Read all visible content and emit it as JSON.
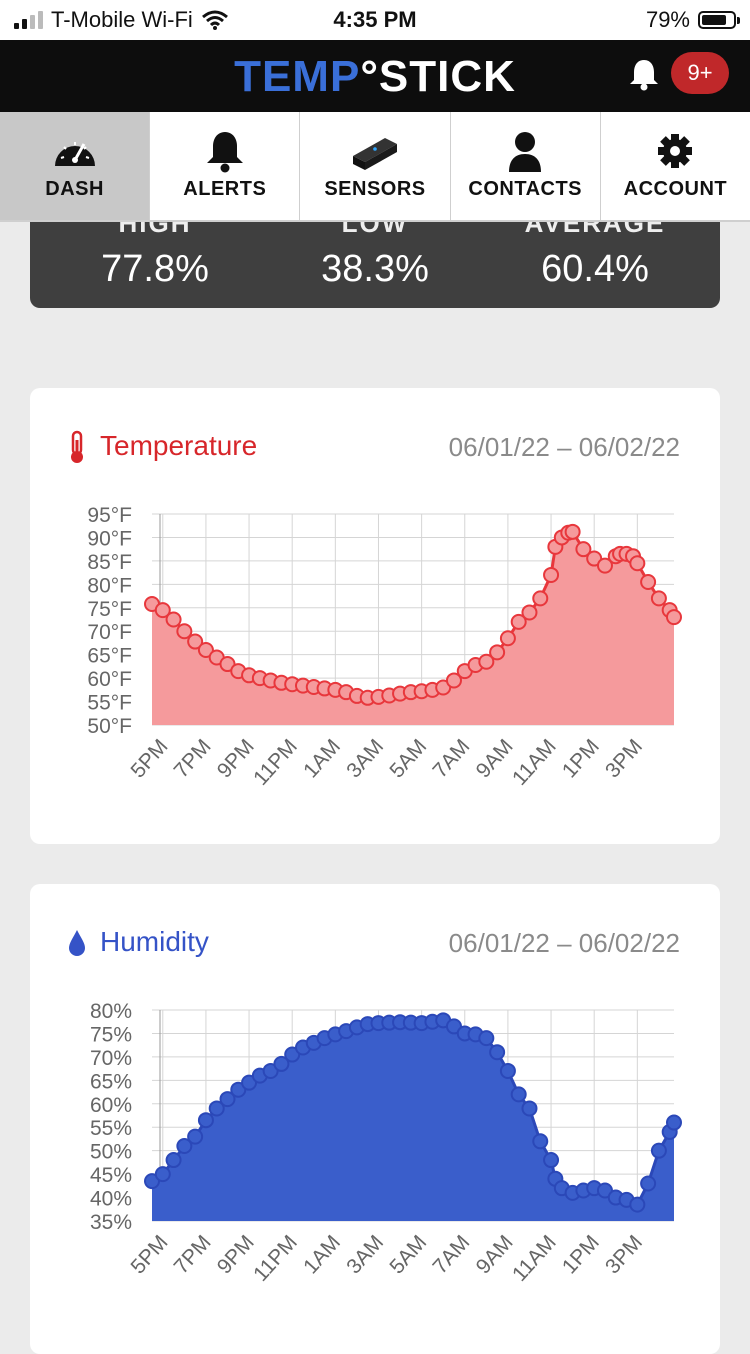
{
  "status_bar": {
    "carrier": "T-Mobile Wi-Fi",
    "time": "4:35 PM",
    "battery": "79%",
    "battery_level": 0.79
  },
  "app": {
    "logo_part1": "TEMP",
    "logo_part2": "STICK",
    "notification_badge": "9+",
    "brand_color": "#3a6fd8"
  },
  "tabs": [
    {
      "label": "DASH",
      "icon": "gauge-icon",
      "active": true
    },
    {
      "label": "ALERTS",
      "icon": "bell-icon",
      "active": false
    },
    {
      "label": "SENSORS",
      "icon": "sensor-icon",
      "active": false
    },
    {
      "label": "CONTACTS",
      "icon": "person-icon",
      "active": false
    },
    {
      "label": "ACCOUNT",
      "icon": "gear-icon",
      "active": false
    }
  ],
  "stats": [
    {
      "label": "HIGH",
      "value": "77.8%"
    },
    {
      "label": "LOW",
      "value": "38.3%"
    },
    {
      "label": "AVERAGE",
      "value": "60.4%"
    }
  ],
  "temperature_card": {
    "title": "Temperature",
    "date_range": "06/01/22 – 06/02/22",
    "color": "#d7262a"
  },
  "humidity_card": {
    "title": "Humidity",
    "date_range": "06/01/22 – 06/02/22",
    "color": "#3553c7"
  },
  "chart_data": [
    {
      "type": "area",
      "x_ticks": [
        "5PM",
        "7PM",
        "9PM",
        "11PM",
        "1AM",
        "3AM",
        "5AM",
        "7AM",
        "9AM",
        "11AM",
        "1PM",
        "3PM"
      ],
      "y_ticks": [
        "95°F",
        "90°F",
        "85°F",
        "80°F",
        "75°F",
        "70°F",
        "65°F",
        "60°F",
        "55°F",
        "50°F"
      ],
      "ylim": [
        50,
        95
      ],
      "xlim": [
        -0.25,
        11.85
      ],
      "grid": true,
      "fill": "#f59a9c",
      "line": "#e8373c",
      "series": [
        {
          "x": [
            -0.25,
            0.0,
            0.25,
            0.5,
            0.75,
            1.0,
            1.25,
            1.5,
            1.75,
            2.0,
            2.25,
            2.5,
            2.75,
            3.0,
            3.25,
            3.5,
            3.75,
            4.0,
            4.25,
            4.5,
            4.75,
            5.0,
            5.25,
            5.5,
            5.75,
            6.0,
            6.25,
            6.5,
            6.75,
            7.0,
            7.25,
            7.5,
            7.75,
            8.0,
            8.25,
            8.5,
            8.75,
            9.0,
            9.1,
            9.25,
            9.4,
            9.5,
            9.75,
            10.0,
            10.25,
            10.5,
            10.6,
            10.75,
            10.9,
            11.0,
            11.25,
            11.5,
            11.75,
            11.85
          ],
          "y": [
            75.8,
            74.5,
            72.5,
            70.0,
            67.8,
            66.0,
            64.4,
            63.0,
            61.5,
            60.6,
            60.0,
            59.5,
            59.0,
            58.7,
            58.4,
            58.1,
            57.8,
            57.5,
            57.0,
            56.2,
            55.8,
            56.0,
            56.3,
            56.7,
            57.0,
            57.2,
            57.5,
            58.0,
            59.5,
            61.5,
            62.8,
            63.5,
            65.5,
            68.5,
            72.0,
            74.0,
            77.0,
            82.0,
            88.0,
            90.0,
            91.0,
            91.2,
            87.5,
            85.5,
            84.0,
            86.0,
            86.5,
            86.5,
            86.0,
            84.5,
            80.5,
            77.0,
            74.5,
            73.0
          ]
        }
      ]
    },
    {
      "type": "area",
      "x_ticks": [
        "5PM",
        "7PM",
        "9PM",
        "11PM",
        "1AM",
        "3AM",
        "5AM",
        "7AM",
        "9AM",
        "11AM",
        "1PM",
        "3PM"
      ],
      "y_ticks": [
        "80%",
        "75%",
        "70%",
        "65%",
        "60%",
        "55%",
        "50%",
        "45%",
        "40%",
        "35%"
      ],
      "ylim": [
        35,
        80
      ],
      "xlim": [
        -0.25,
        11.85
      ],
      "grid": true,
      "fill": "#3a5ecb",
      "line": "#2b48b8",
      "series": [
        {
          "x": [
            -0.25,
            0.0,
            0.25,
            0.5,
            0.75,
            1.0,
            1.25,
            1.5,
            1.75,
            2.0,
            2.25,
            2.5,
            2.75,
            3.0,
            3.25,
            3.5,
            3.75,
            4.0,
            4.25,
            4.5,
            4.75,
            5.0,
            5.25,
            5.5,
            5.75,
            6.0,
            6.25,
            6.5,
            6.75,
            7.0,
            7.25,
            7.5,
            7.75,
            8.0,
            8.25,
            8.5,
            8.75,
            9.0,
            9.1,
            9.25,
            9.5,
            9.75,
            10.0,
            10.25,
            10.5,
            10.75,
            11.0,
            11.25,
            11.5,
            11.75,
            11.85
          ],
          "y": [
            43.5,
            45.0,
            48.0,
            51.0,
            53.0,
            56.5,
            59.0,
            61.0,
            63.0,
            64.5,
            66.0,
            67.0,
            68.5,
            70.5,
            72.0,
            73.0,
            74.0,
            74.8,
            75.5,
            76.3,
            77.0,
            77.2,
            77.3,
            77.4,
            77.3,
            77.2,
            77.5,
            77.8,
            76.5,
            75.0,
            74.8,
            74.0,
            71.0,
            67.0,
            62.0,
            59.0,
            52.0,
            48.0,
            44.0,
            42.0,
            41.0,
            41.5,
            42.0,
            41.5,
            40.0,
            39.5,
            38.5,
            43.0,
            50.0,
            54.0,
            56.0
          ]
        }
      ]
    }
  ]
}
